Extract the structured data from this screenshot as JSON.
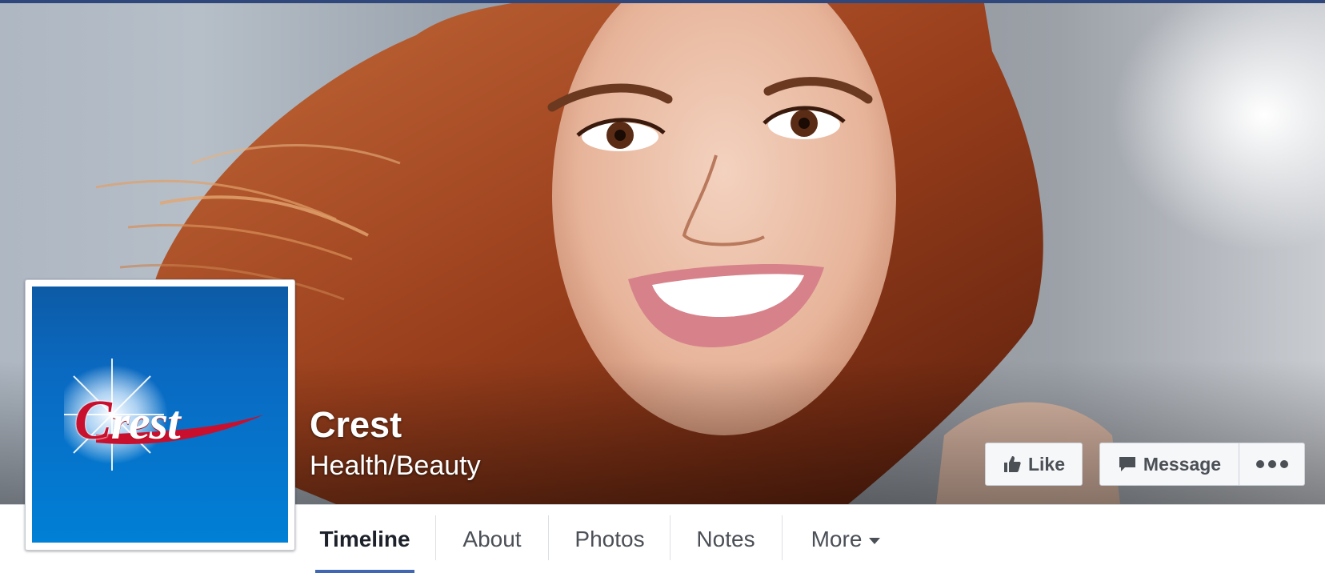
{
  "page": {
    "name": "Crest",
    "category": "Health/Beauty"
  },
  "profile": {
    "logo_text": "Crest",
    "logo_icon": "crest-logo"
  },
  "actions": {
    "like_label": "Like",
    "like_icon": "thumbs-up-icon",
    "message_label": "Message",
    "message_icon": "speech-bubble-icon",
    "more_icon": "ellipsis-icon"
  },
  "tabs": [
    {
      "label": "Timeline",
      "active": true
    },
    {
      "label": "About",
      "active": false
    },
    {
      "label": "Photos",
      "active": false
    },
    {
      "label": "Notes",
      "active": false
    },
    {
      "label": "More",
      "active": false,
      "has_dropdown": true
    }
  ],
  "colors": {
    "accent": "#4267b2",
    "crest_blue": "#0a6ac2",
    "crest_red": "#c8102e",
    "top_strip": "#2f477a"
  }
}
